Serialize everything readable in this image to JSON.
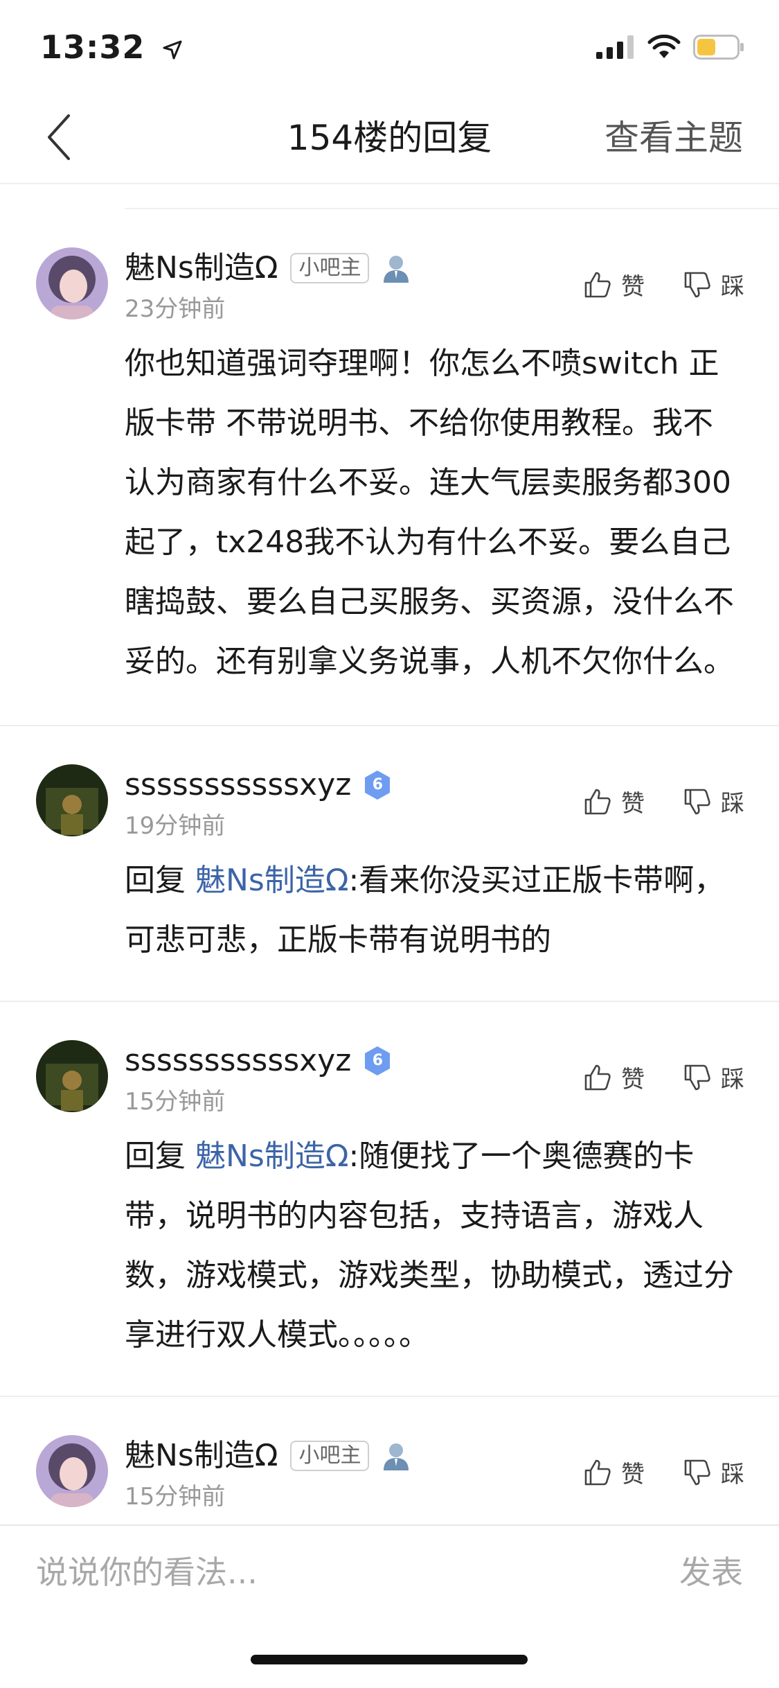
{
  "status_bar": {
    "time": "13:32",
    "battery_color": "#f5c542"
  },
  "header": {
    "title": "154楼的回复",
    "action": "查看主题"
  },
  "replies": [
    {
      "username": "魅Ns制造Ω",
      "role_badge": "小吧主",
      "time": "23分钟前",
      "prefix": "",
      "mention": "",
      "text": "你也知道强词夺理啊！你怎么不喷switch 正版卡带 不带说明书、不给你使用教程。我不认为商家有什么不妥。连大气层卖服务都300起了，tx248我不认为有什么不妥。要么自己瞎捣鼓、要么自己买服务、买资源，没什么不妥的。还有别拿义务说事，人机不欠你什么。",
      "like_label": "赞",
      "dislike_label": "踩"
    },
    {
      "username": "sssssssssssxyz",
      "level": "6",
      "time": "19分钟前",
      "prefix": "回复 ",
      "mention": "魅Ns制造Ω",
      "text": ":看来你没买过正版卡带啊，可悲可悲，正版卡带有说明书的",
      "like_label": "赞",
      "dislike_label": "踩"
    },
    {
      "username": "sssssssssssxyz",
      "level": "6",
      "time": "15分钟前",
      "prefix": "回复 ",
      "mention": "魅Ns制造Ω",
      "text": ":随便找了一个奥德赛的卡带，说明书的内容包括，支持语言，游戏人数，游戏模式，游戏类型，协助模式，透过分享进行双人模式。。。。。",
      "like_label": "赞",
      "dislike_label": "踩"
    },
    {
      "username": "魅Ns制造Ω",
      "role_badge": "小吧主",
      "time": "15分钟前",
      "like_label": "赞",
      "dislike_label": "踩"
    }
  ],
  "input": {
    "placeholder": "说说你的看法...",
    "send_label": "发表"
  },
  "colors": {
    "mention": "#3c64a8",
    "level_badge": "#6e9cf0"
  }
}
